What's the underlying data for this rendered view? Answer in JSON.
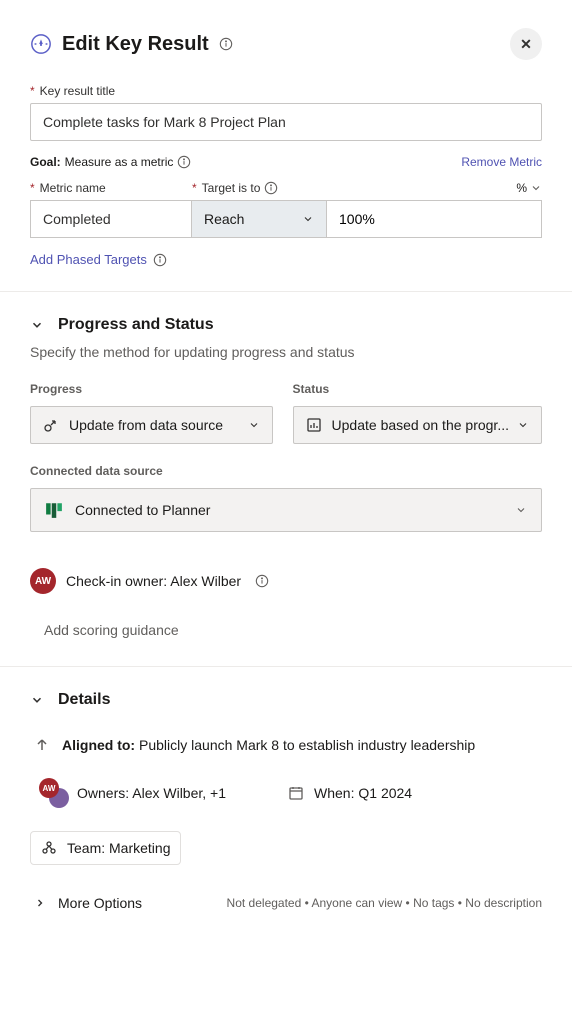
{
  "header": {
    "title": "Edit Key Result"
  },
  "form": {
    "title_label": "Key result title",
    "title_value": "Complete tasks for Mark 8 Project Plan",
    "goal_prefix": "Goal:",
    "goal_text": "Measure as a metric",
    "remove_metric": "Remove Metric",
    "metric_name_label": "Metric name",
    "metric_name_value": "Completed",
    "target_label": "Target is to",
    "target_unit": "%",
    "reach_value": "Reach",
    "target_value": "100%",
    "phased_link": "Add Phased Targets"
  },
  "progress": {
    "section_title": "Progress and Status",
    "subtitle": "Specify the method for updating progress and status",
    "progress_label": "Progress",
    "status_label": "Status",
    "progress_value": "Update from data source",
    "status_value": "Update based on the progr...",
    "connected_label": "Connected data source",
    "connected_value": "Connected to Planner",
    "checkin_owner_label": "Check-in owner:",
    "checkin_owner_name": "Alex Wilber",
    "checkin_initials": "AW",
    "guidance": "Add scoring guidance"
  },
  "details": {
    "section_title": "Details",
    "aligned_label": "Aligned to:",
    "aligned_value": "Publicly launch Mark 8 to establish industry leadership",
    "owners_label": "Owners:",
    "owners_value": "Alex Wilber, +1",
    "when_label": "When:",
    "when_value": "Q1 2024",
    "team_label": "Team:",
    "team_value": "Marketing",
    "more_options": "More Options",
    "footer_text": "Not delegated • Anyone can view • No tags • No description"
  }
}
